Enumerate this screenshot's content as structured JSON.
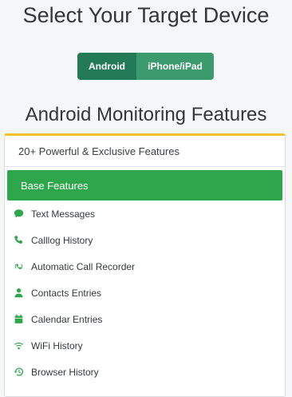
{
  "page": {
    "title": "Select Your Target Device",
    "subtitle": "Android Monitoring Features"
  },
  "toggle": {
    "active": "Android",
    "inactive": "iPhone/iPad"
  },
  "card": {
    "header": "20+ Powerful & Exclusive Features",
    "base_title": "Base Features",
    "items": [
      {
        "label": "Text Messages",
        "icon": "chat-icon"
      },
      {
        "label": "Calllog History",
        "icon": "phone-icon"
      },
      {
        "label": "Automatic Call Recorder",
        "icon": "call-recorder-icon"
      },
      {
        "label": "Contacts Entries",
        "icon": "user-icon"
      },
      {
        "label": "Calendar Entries",
        "icon": "calendar-icon"
      },
      {
        "label": "WiFi History",
        "icon": "wifi-icon"
      },
      {
        "label": "Browser History",
        "icon": "history-icon"
      }
    ]
  },
  "colors": {
    "accent_green": "#2ea64c",
    "toggle_active": "#237a57",
    "toggle_inactive": "#3c9a6f",
    "card_top_border": "#f2c12e"
  }
}
